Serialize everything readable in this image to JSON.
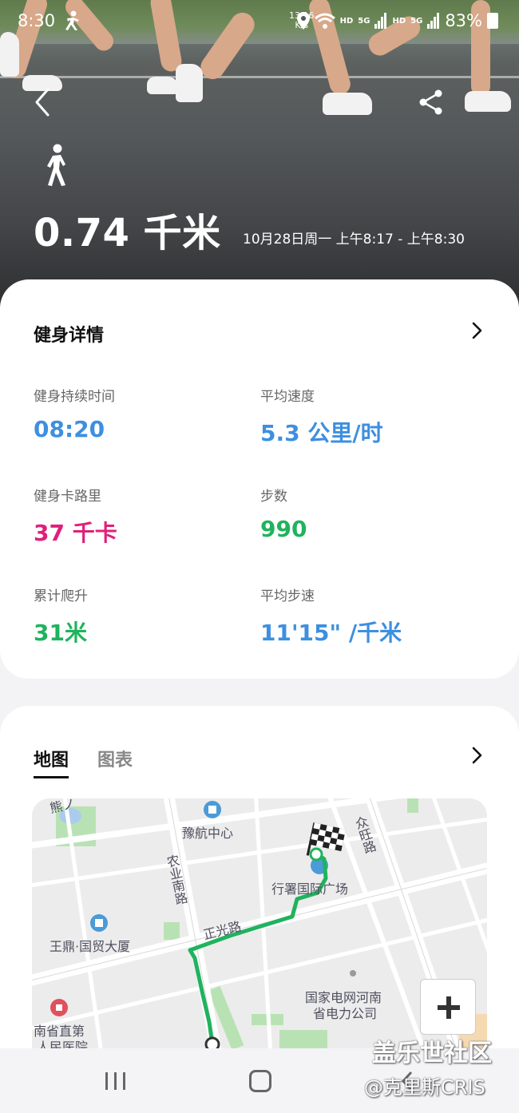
{
  "status_bar": {
    "time": "8:30",
    "net_speed_line1": "13.16",
    "net_speed_line2": "K/s",
    "battery": "83%",
    "hd1": "HD",
    "g1": "5G",
    "hd2": "HD",
    "g2": "5G"
  },
  "header": {
    "distance": "0.74 千米",
    "time_range": "10月28日周一 上午8:17 - 上午8:30"
  },
  "details": {
    "title": "健身详情",
    "metrics": [
      {
        "label": "健身持续时间",
        "value": "08:20",
        "color": "#3d8fe0"
      },
      {
        "label": "平均速度",
        "value": "5.3 公里/时",
        "color": "#3d8fe0"
      },
      {
        "label": "健身卡路里",
        "value": "37 千卡",
        "color": "#e0207a"
      },
      {
        "label": "步数",
        "value": "990",
        "color": "#1fb35e"
      },
      {
        "label": "累计爬升",
        "value": "31米",
        "color": "#1fb35e"
      },
      {
        "label": "平均步速",
        "value": "11'15\" /千米",
        "color": "#3d8fe0"
      }
    ]
  },
  "map_card": {
    "tabs": [
      "地图",
      "图表"
    ],
    "labels": {
      "yuhang": "豫航中心",
      "nongye_road": "农业南路",
      "zhongwang_road": "众旺路",
      "xingshu": "行署国际广场",
      "zhengguang_road": "正光路",
      "wangding": "王鼎·国贸大厦",
      "state_grid_1": "国家电网河南",
      "state_grid_2": "省电力公司",
      "hospital_1": "南省直第",
      "hospital_2": "人民医院",
      "top_left": "熊ノ"
    }
  },
  "watermark": {
    "line1": "盖乐世社区",
    "line2": "@克里斯CRIS"
  },
  "colors": {
    "route": "#1fb35e",
    "accent_blue": "#3d8fe0",
    "accent_pink": "#e0207a",
    "accent_green": "#1fb35e"
  }
}
